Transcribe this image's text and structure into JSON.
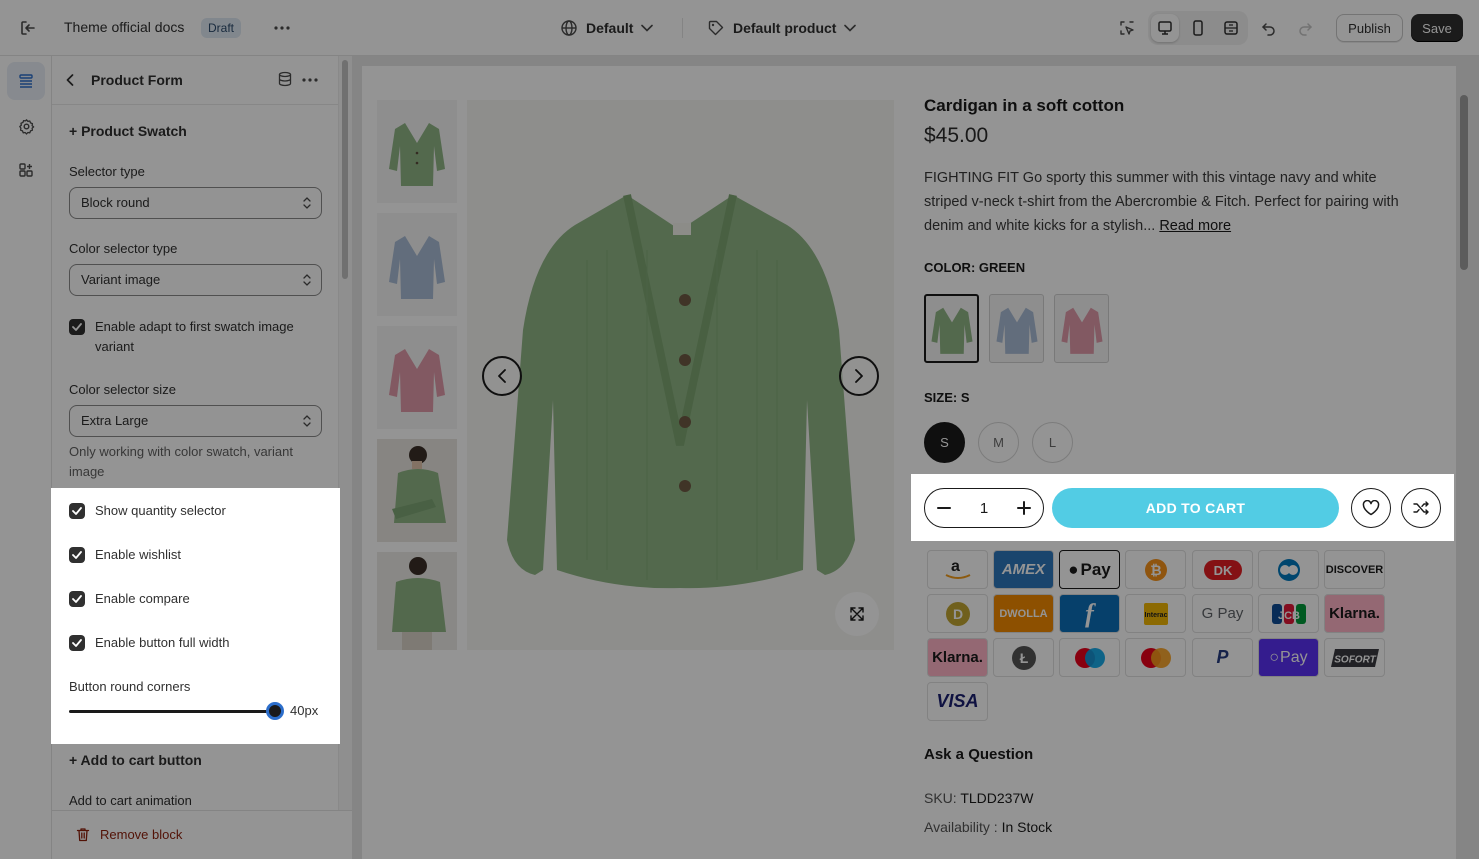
{
  "topbar": {
    "title": "Theme official docs",
    "status": "Draft",
    "theme_label": "Default",
    "template_label": "Default product",
    "publish_label": "Publish",
    "save_label": "Save"
  },
  "rail": {
    "items": [
      {
        "icon": "sections-icon",
        "active": true
      },
      {
        "icon": "gear-icon",
        "active": false
      },
      {
        "icon": "apps-icon",
        "active": false
      }
    ]
  },
  "panel": {
    "title": "Product Form",
    "section_swatch": "+ Product Swatch",
    "selector_type_label": "Selector type",
    "selector_type_value": "Block round",
    "color_selector_type_label": "Color selector type",
    "color_selector_type_value": "Variant image",
    "adapt_label": "Enable adapt to first swatch image variant",
    "color_selector_size_label": "Color selector size",
    "color_selector_size_value": "Extra Large",
    "size_help": "Only working with color swatch, variant image",
    "show_qty_label": "Show quantity selector",
    "wishlist_label": "Enable wishlist",
    "compare_label": "Enable compare",
    "full_width_label": "Enable button full width",
    "round_corners_label": "Button round corners",
    "round_corners_value": "40px",
    "round_corners_level": 1.0,
    "section_cart": "+ Add to cart button",
    "animation_label": "Add to cart animation",
    "remove_label": "Remove block"
  },
  "product": {
    "title": "Cardigan in a soft cotton",
    "price": "$45.00",
    "description": "FIGHTING FIT Go sporty this summer with this vintage navy and white striped v-neck t-shirt from the Abercrombie & Fitch. Perfect for pairing with denim and white kicks for a stylish...",
    "read_more": "Read more",
    "color_label": "COLOR: GREEN",
    "size_label": "SIZE: S",
    "sizes": [
      "S",
      "M",
      "L"
    ],
    "quantity": "1",
    "add_to_cart": "ADD TO CART",
    "ask": "Ask a Question",
    "sku_key": "SKU:",
    "sku_value": "TLDD237W",
    "avail_key": "Availability :",
    "avail_value": "In Stock"
  },
  "payments": {
    "amex": "AMEX",
    "apple_pay": "Pay",
    "dwolla": "DWOLLA",
    "interac": "Interac",
    "gpay": "G Pay",
    "jcb": "JCB",
    "klarna": "Klarna.",
    "opay": "Pay",
    "sofort": "SOFORT",
    "visa": "VISA",
    "discover": "DISCOVER"
  },
  "colors": {
    "accent": "#52cce4",
    "dark": "#303030",
    "sweater_green": "#8fb585",
    "sweater_blue": "#a9bcd6",
    "sweater_pink": "#e09aaa"
  }
}
